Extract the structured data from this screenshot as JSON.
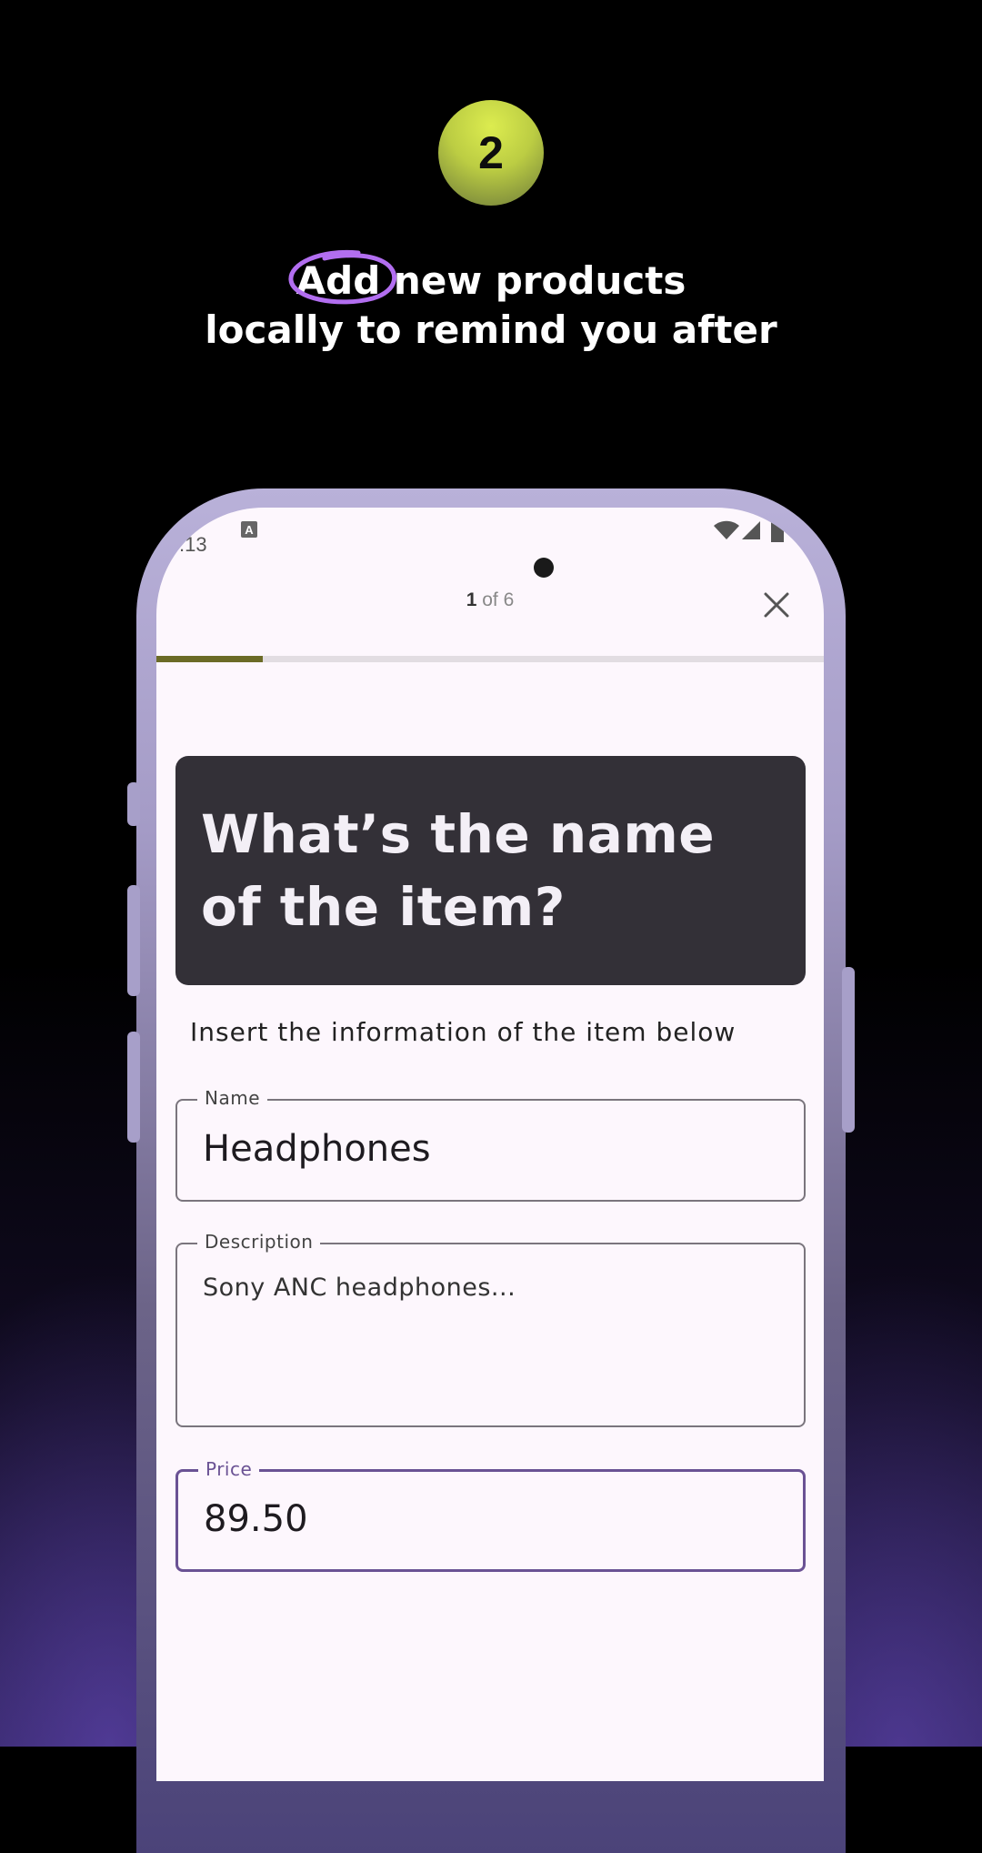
{
  "step": {
    "number": "2"
  },
  "headline": {
    "highlight": "Add",
    "line1_rest": " new products",
    "line2": "locally to remind you after"
  },
  "colors": {
    "accent_circle": "#b26ef0",
    "badge": "#c6d846",
    "progress_fill": "#6b6b26",
    "focused_border": "#6a5294"
  },
  "status_bar": {
    "time": ":13",
    "icons": [
      "a-notification-icon",
      "wifi-icon",
      "cell-signal-icon",
      "battery-icon"
    ]
  },
  "header": {
    "pager_current": "1",
    "pager_rest": " of 6",
    "close_icon": "close-icon",
    "progress": 0.16
  },
  "question": {
    "title": "What’s the name of the item?",
    "subtitle": "Insert the information of the item below"
  },
  "form": {
    "name": {
      "label": "Name",
      "value": "Headphones"
    },
    "description": {
      "label": "Description",
      "value": "Sony ANC headphones..."
    },
    "price": {
      "label": "Price",
      "value": "89.50"
    }
  }
}
